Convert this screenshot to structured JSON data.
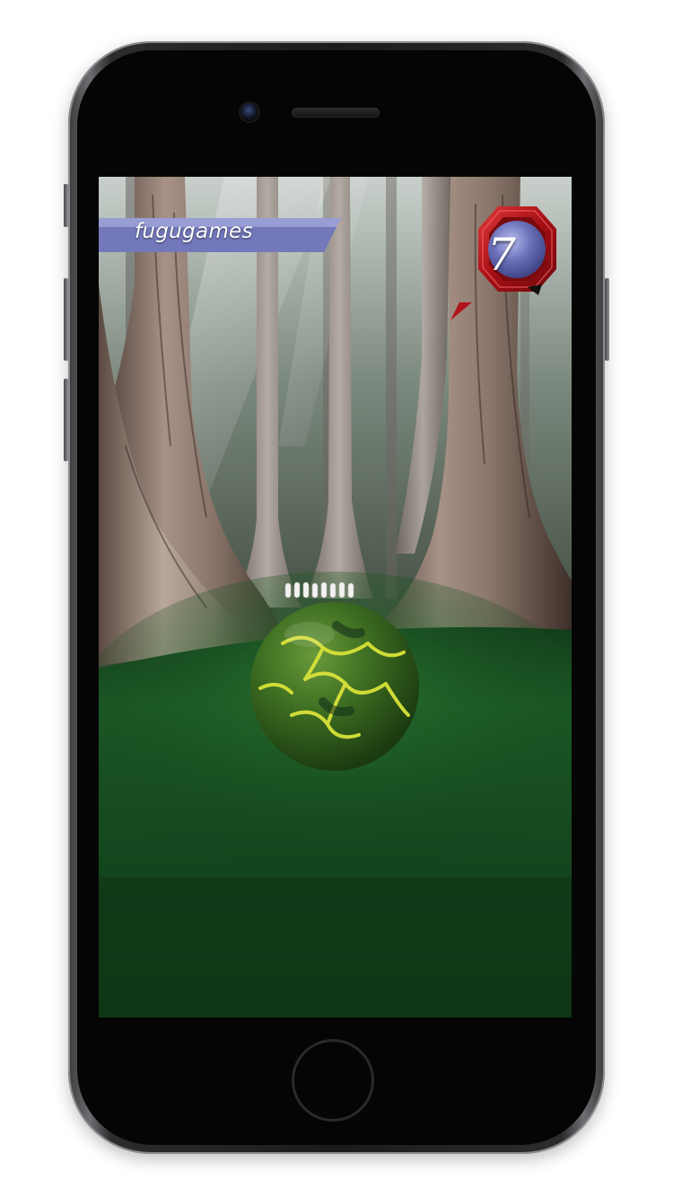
{
  "device": {
    "model_icon": "iphone-frame"
  },
  "game": {
    "player_name": "fugugames",
    "pins_count": "7",
    "ball_icon": "bowling-ball-green-yellow-veins",
    "scene": "forest-bowling-lane",
    "colors": {
      "badge": "#7378bb",
      "medallion_ring": "#c21a1e",
      "medallion_face": "#6a70b8",
      "lane_green": "#1f5a26",
      "ball_green": "#3f6f22",
      "ball_vein": "#d9e23a"
    }
  }
}
